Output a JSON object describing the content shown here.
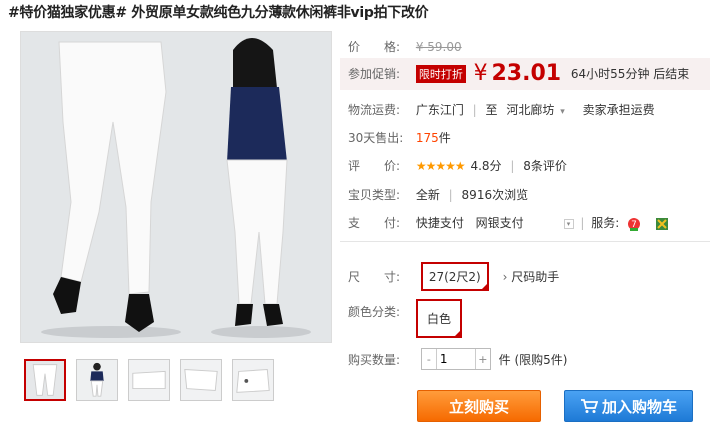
{
  "title": "#特价猫独家优惠# 外贸原单女款纯色九分薄款休闲裤非vip拍下改价",
  "price": {
    "label": "价　　格:",
    "value": "¥ 59.00"
  },
  "promo": {
    "label": "参加促销:",
    "tag": "限时打折",
    "yen": "¥",
    "value": "23.01",
    "countdown": "64小时55分钟 后结束"
  },
  "shipping": {
    "label": "物流运费:",
    "from": "广东江门",
    "sep": "|",
    "to_prefix": "至",
    "to": "河北廊坊",
    "note": "卖家承担运费"
  },
  "sold": {
    "label": "30天售出:",
    "value": "175",
    "unit": "件"
  },
  "rating": {
    "label": "评　　价:",
    "stars": "★★★★★",
    "score": "4.8分",
    "reviews": "8条评价"
  },
  "type": {
    "label": "宝贝类型:",
    "value": "全新",
    "views": "8916次浏览"
  },
  "payment": {
    "label": "支　　付:",
    "method1": "快捷支付",
    "method2": "网银支付",
    "service_label": "服务:"
  },
  "size": {
    "label": "尺　　寸:",
    "selected": "27(2尺2)",
    "guide": "尺码助手"
  },
  "color": {
    "label": "颜色分类:",
    "selected": "白色"
  },
  "quantity": {
    "label": "购买数量:",
    "value": "1",
    "minus": "-",
    "plus": "+",
    "unit": "件 (限购5件)"
  },
  "buttons": {
    "buy": "立刻购买",
    "cart": "加入购物车"
  },
  "colors": {
    "accent": "#c40000",
    "buy": "#f66a00",
    "cart": "#1e7ad6"
  }
}
